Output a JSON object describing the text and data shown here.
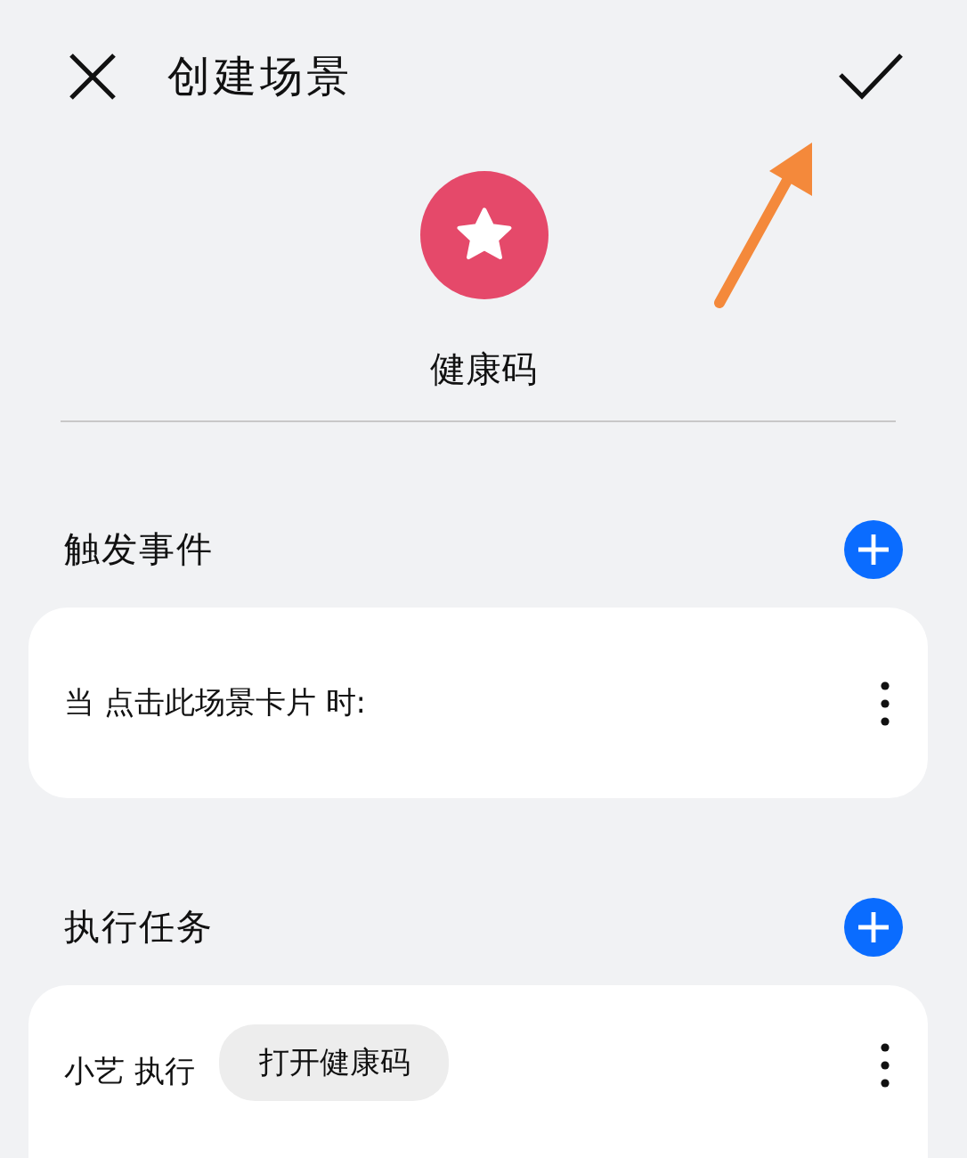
{
  "header": {
    "title": "创建场景"
  },
  "scene": {
    "name": "健康码",
    "color": "#e5496a"
  },
  "sections": [
    {
      "title": "触发事件",
      "rows": [
        {
          "text": "当 点击此场景卡片 时:"
        }
      ]
    },
    {
      "title": "执行任务",
      "rows": [
        {
          "text": "小艺 执行",
          "chip": "打开健康码"
        }
      ]
    }
  ]
}
